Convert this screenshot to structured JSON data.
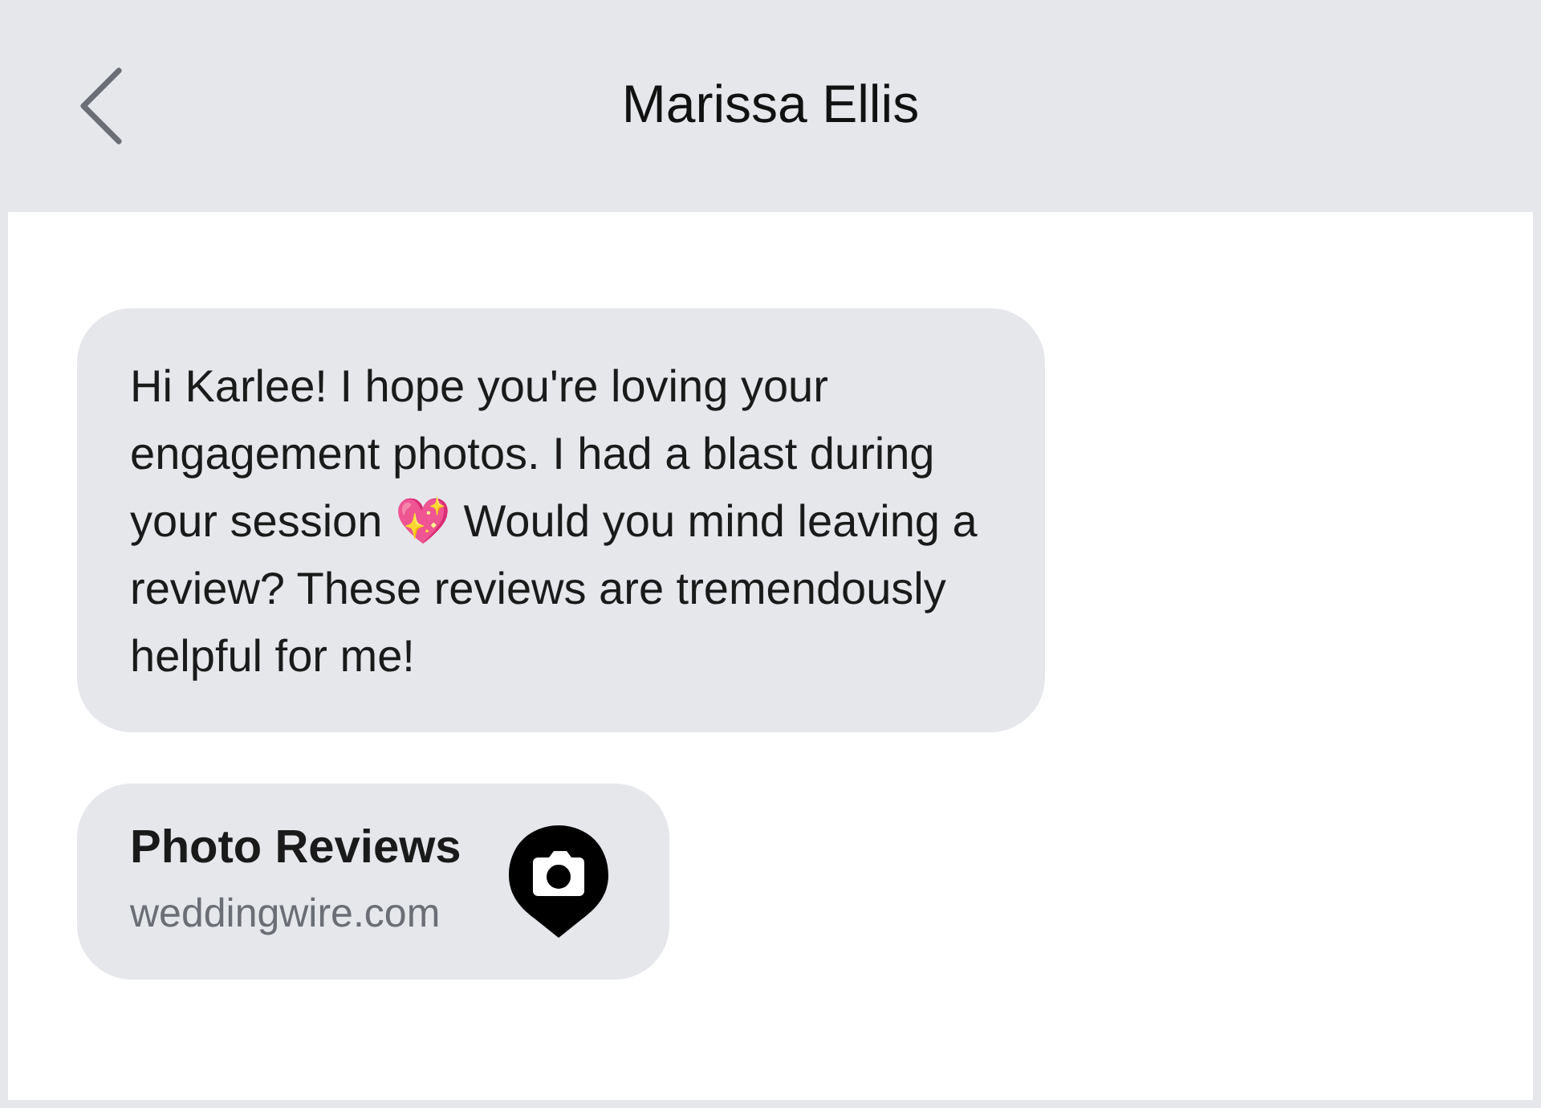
{
  "header": {
    "title": "Marissa Ellis"
  },
  "messages": [
    {
      "kind": "text",
      "text": "Hi Karlee! I hope you're loving your engagement photos. I had a blast during your session 💖 Would you mind leaving a review? These reviews are tremendously helpful for me!"
    },
    {
      "kind": "link",
      "title": "Photo Reviews",
      "domain": "weddingwire.com"
    }
  ]
}
